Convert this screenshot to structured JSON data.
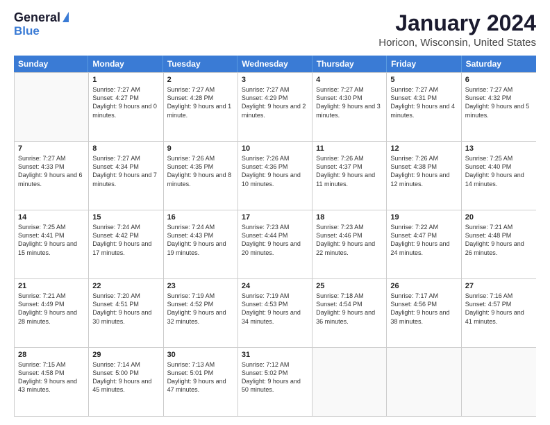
{
  "logo": {
    "line1": "General",
    "line2": "Blue"
  },
  "title": "January 2024",
  "subtitle": "Horicon, Wisconsin, United States",
  "headers": [
    "Sunday",
    "Monday",
    "Tuesday",
    "Wednesday",
    "Thursday",
    "Friday",
    "Saturday"
  ],
  "weeks": [
    [
      {
        "day": "",
        "sunrise": "",
        "sunset": "",
        "daylight": ""
      },
      {
        "day": "1",
        "sunrise": "Sunrise: 7:27 AM",
        "sunset": "Sunset: 4:27 PM",
        "daylight": "Daylight: 9 hours and 0 minutes."
      },
      {
        "day": "2",
        "sunrise": "Sunrise: 7:27 AM",
        "sunset": "Sunset: 4:28 PM",
        "daylight": "Daylight: 9 hours and 1 minute."
      },
      {
        "day": "3",
        "sunrise": "Sunrise: 7:27 AM",
        "sunset": "Sunset: 4:29 PM",
        "daylight": "Daylight: 9 hours and 2 minutes."
      },
      {
        "day": "4",
        "sunrise": "Sunrise: 7:27 AM",
        "sunset": "Sunset: 4:30 PM",
        "daylight": "Daylight: 9 hours and 3 minutes."
      },
      {
        "day": "5",
        "sunrise": "Sunrise: 7:27 AM",
        "sunset": "Sunset: 4:31 PM",
        "daylight": "Daylight: 9 hours and 4 minutes."
      },
      {
        "day": "6",
        "sunrise": "Sunrise: 7:27 AM",
        "sunset": "Sunset: 4:32 PM",
        "daylight": "Daylight: 9 hours and 5 minutes."
      }
    ],
    [
      {
        "day": "7",
        "sunrise": "Sunrise: 7:27 AM",
        "sunset": "Sunset: 4:33 PM",
        "daylight": "Daylight: 9 hours and 6 minutes."
      },
      {
        "day": "8",
        "sunrise": "Sunrise: 7:27 AM",
        "sunset": "Sunset: 4:34 PM",
        "daylight": "Daylight: 9 hours and 7 minutes."
      },
      {
        "day": "9",
        "sunrise": "Sunrise: 7:26 AM",
        "sunset": "Sunset: 4:35 PM",
        "daylight": "Daylight: 9 hours and 8 minutes."
      },
      {
        "day": "10",
        "sunrise": "Sunrise: 7:26 AM",
        "sunset": "Sunset: 4:36 PM",
        "daylight": "Daylight: 9 hours and 10 minutes."
      },
      {
        "day": "11",
        "sunrise": "Sunrise: 7:26 AM",
        "sunset": "Sunset: 4:37 PM",
        "daylight": "Daylight: 9 hours and 11 minutes."
      },
      {
        "day": "12",
        "sunrise": "Sunrise: 7:26 AM",
        "sunset": "Sunset: 4:38 PM",
        "daylight": "Daylight: 9 hours and 12 minutes."
      },
      {
        "day": "13",
        "sunrise": "Sunrise: 7:25 AM",
        "sunset": "Sunset: 4:40 PM",
        "daylight": "Daylight: 9 hours and 14 minutes."
      }
    ],
    [
      {
        "day": "14",
        "sunrise": "Sunrise: 7:25 AM",
        "sunset": "Sunset: 4:41 PM",
        "daylight": "Daylight: 9 hours and 15 minutes."
      },
      {
        "day": "15",
        "sunrise": "Sunrise: 7:24 AM",
        "sunset": "Sunset: 4:42 PM",
        "daylight": "Daylight: 9 hours and 17 minutes."
      },
      {
        "day": "16",
        "sunrise": "Sunrise: 7:24 AM",
        "sunset": "Sunset: 4:43 PM",
        "daylight": "Daylight: 9 hours and 19 minutes."
      },
      {
        "day": "17",
        "sunrise": "Sunrise: 7:23 AM",
        "sunset": "Sunset: 4:44 PM",
        "daylight": "Daylight: 9 hours and 20 minutes."
      },
      {
        "day": "18",
        "sunrise": "Sunrise: 7:23 AM",
        "sunset": "Sunset: 4:46 PM",
        "daylight": "Daylight: 9 hours and 22 minutes."
      },
      {
        "day": "19",
        "sunrise": "Sunrise: 7:22 AM",
        "sunset": "Sunset: 4:47 PM",
        "daylight": "Daylight: 9 hours and 24 minutes."
      },
      {
        "day": "20",
        "sunrise": "Sunrise: 7:21 AM",
        "sunset": "Sunset: 4:48 PM",
        "daylight": "Daylight: 9 hours and 26 minutes."
      }
    ],
    [
      {
        "day": "21",
        "sunrise": "Sunrise: 7:21 AM",
        "sunset": "Sunset: 4:49 PM",
        "daylight": "Daylight: 9 hours and 28 minutes."
      },
      {
        "day": "22",
        "sunrise": "Sunrise: 7:20 AM",
        "sunset": "Sunset: 4:51 PM",
        "daylight": "Daylight: 9 hours and 30 minutes."
      },
      {
        "day": "23",
        "sunrise": "Sunrise: 7:19 AM",
        "sunset": "Sunset: 4:52 PM",
        "daylight": "Daylight: 9 hours and 32 minutes."
      },
      {
        "day": "24",
        "sunrise": "Sunrise: 7:19 AM",
        "sunset": "Sunset: 4:53 PM",
        "daylight": "Daylight: 9 hours and 34 minutes."
      },
      {
        "day": "25",
        "sunrise": "Sunrise: 7:18 AM",
        "sunset": "Sunset: 4:54 PM",
        "daylight": "Daylight: 9 hours and 36 minutes."
      },
      {
        "day": "26",
        "sunrise": "Sunrise: 7:17 AM",
        "sunset": "Sunset: 4:56 PM",
        "daylight": "Daylight: 9 hours and 38 minutes."
      },
      {
        "day": "27",
        "sunrise": "Sunrise: 7:16 AM",
        "sunset": "Sunset: 4:57 PM",
        "daylight": "Daylight: 9 hours and 41 minutes."
      }
    ],
    [
      {
        "day": "28",
        "sunrise": "Sunrise: 7:15 AM",
        "sunset": "Sunset: 4:58 PM",
        "daylight": "Daylight: 9 hours and 43 minutes."
      },
      {
        "day": "29",
        "sunrise": "Sunrise: 7:14 AM",
        "sunset": "Sunset: 5:00 PM",
        "daylight": "Daylight: 9 hours and 45 minutes."
      },
      {
        "day": "30",
        "sunrise": "Sunrise: 7:13 AM",
        "sunset": "Sunset: 5:01 PM",
        "daylight": "Daylight: 9 hours and 47 minutes."
      },
      {
        "day": "31",
        "sunrise": "Sunrise: 7:12 AM",
        "sunset": "Sunset: 5:02 PM",
        "daylight": "Daylight: 9 hours and 50 minutes."
      },
      {
        "day": "",
        "sunrise": "",
        "sunset": "",
        "daylight": ""
      },
      {
        "day": "",
        "sunrise": "",
        "sunset": "",
        "daylight": ""
      },
      {
        "day": "",
        "sunrise": "",
        "sunset": "",
        "daylight": ""
      }
    ]
  ]
}
